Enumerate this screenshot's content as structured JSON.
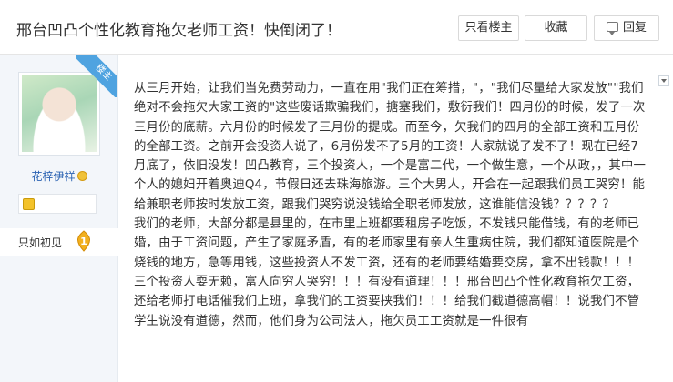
{
  "header": {
    "title": "邢台凹凸个性化教育拖欠老师工资！快倒闭了！",
    "only_op_label": "只看楼主",
    "favorite_label": "收藏",
    "reply_label": "回复",
    "reply_icon": "reply-icon"
  },
  "author": {
    "badge": "楼主",
    "name": "花梓伊祥",
    "level_name": "只如初见",
    "level": "1",
    "colors": {
      "name": "#2d64b3",
      "badge": "#4fa3e0",
      "level_leaf": "#f2b01e"
    }
  },
  "post": {
    "text": "从三月开始，让我们当免费劳动力，一直在用\"我们正在筹措，\"，\"我们尽量给大家发放\"\"我们绝对不会拖欠大家工资的\"这些废话欺骗我们，搪塞我们，敷衍我们！四月份的时候，发了一次三月份的底薪。六月份的时候发了三月份的提成。而至今，欠我们的四月的全部工资和五月份的全部工资。之前开会投资人说了，6月份发不了5月的工资！人家就说了发不了！现在已经7月底了，依旧没发！凹凸教育，三个投资人，一个是富二代，一个做生意，一个从政，，其中一个人的媳妇开着奥迪Q4，节假日还去珠海旅游。三个大男人，开会在一起跟我们员工哭穷！能给兼职老师按时发放工资，跟我们哭穷说没钱给全职老师发放，这谁能信没钱？？？？？\n我们的老师，大部分都是县里的，在市里上班都要租房子吃饭，不发钱只能借钱，有的老师已婚，由于工资问题，产生了家庭矛盾，有的老师家里有亲人生重病住院，我们都知道医院是个烧钱的地方，急等用钱，这些投资人不发工资，还有的老师要结婚要交房，拿不出钱款！！！三个投资人耍无赖，富人向穷人哭穷！！！有没有道理！！！邢台凹凸个性化教育拖欠工资，还给老师打电话催我们上班，拿我们的工资要挟我们！！！给我们截道德高帽！！说我们不管学生说没有道德，然而，他们身为公司法人，拖欠员工工资就是一件很有"
  }
}
